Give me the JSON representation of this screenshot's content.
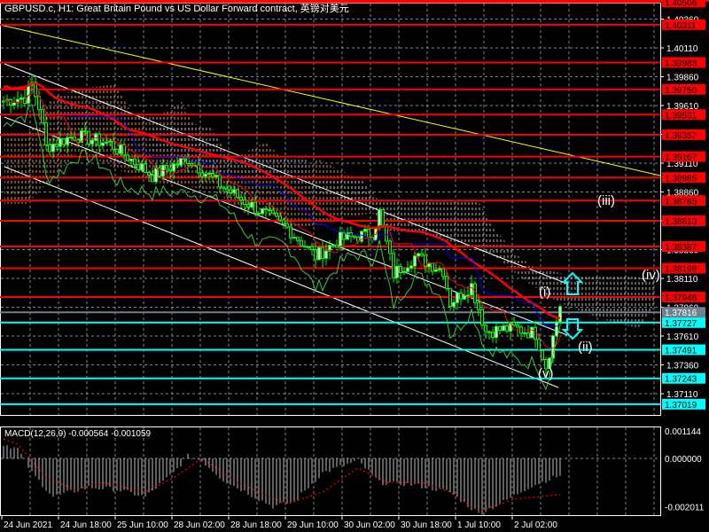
{
  "header": {
    "title": "GBPUSD.c, H1:  Great Britain Pound vs US Dollar Forward contract, 英镑对美元"
  },
  "colors": {
    "background": "#000000",
    "resistance": "#ff0000",
    "support": "#00ffff",
    "current": "#708090",
    "trendline": "#ffff00",
    "channel": "#ffffff",
    "bull_candle": "#00ff00",
    "cloud_a": "#f4a460",
    "cloud_b": "#dcc8c8",
    "kijun": "#0000ff",
    "ma": "#ff0000",
    "oscillator": "#32cd32"
  },
  "chart_data": {
    "type": "candlestick",
    "title": "GBPUSD.c, H1",
    "ylim": [
      1.369,
      1.4055
    ],
    "y_ticks": [
      "1.40360",
      "1.40110",
      "1.39860",
      "1.39610",
      "1.39360",
      "1.39110",
      "1.38860",
      "1.38610",
      "1.38360",
      "1.38110",
      "1.37860",
      "1.37610",
      "1.37360",
      "1.37110"
    ],
    "x_ticks": [
      "24 Jun 2021",
      "24 Jun 18:00",
      "25 Jun 10:00",
      "28 Jun 02:00",
      "28 Jun 18:00",
      "29 Jun 10:00",
      "30 Jun 02:00",
      "30 Jun 18:00",
      "1 Jul 10:00",
      "2 Jul 02:00"
    ],
    "resistance_levels": [
      "1.40506",
      "1.40311",
      "1.39983",
      "1.39750",
      "1.39531",
      "1.39357",
      "1.39167",
      "1.38985",
      "1.38785",
      "1.38610",
      "1.38387",
      "1.38198",
      "1.37948"
    ],
    "support_levels": [
      "1.37727",
      "1.37491",
      "1.37243",
      "1.37019"
    ],
    "current_price": "1.37816",
    "price_path": [
      [
        0,
        1.3965
      ],
      [
        6,
        1.3968
      ],
      [
        8,
        1.398
      ],
      [
        10,
        1.396
      ],
      [
        12,
        1.3925
      ],
      [
        20,
        1.3935
      ],
      [
        30,
        1.3928
      ],
      [
        42,
        1.39
      ],
      [
        52,
        1.3915
      ],
      [
        62,
        1.389
      ],
      [
        72,
        1.387
      ],
      [
        80,
        1.3855
      ],
      [
        88,
        1.383
      ],
      [
        95,
        1.3845
      ],
      [
        104,
        1.385
      ],
      [
        106,
        1.3868
      ],
      [
        110,
        1.3815
      ],
      [
        116,
        1.383
      ],
      [
        124,
        1.3818
      ],
      [
        126,
        1.379
      ],
      [
        132,
        1.3805
      ],
      [
        136,
        1.3765
      ],
      [
        144,
        1.3768
      ],
      [
        150,
        1.3763
      ],
      [
        153,
        1.3735
      ],
      [
        155,
        1.376
      ],
      [
        157,
        1.3788
      ]
    ],
    "wave_labels": [
      "(i)",
      "(ii)",
      "(iii)",
      "(iv)",
      "(v)"
    ],
    "macd": {
      "label": "MACD(12,26,9) -0.000564 -0.001059",
      "ylim": [
        -0.002011,
        0.001144
      ],
      "y_ticks": [
        "0.001144",
        "0.000000",
        "-0.002011"
      ],
      "histogram": [
        [
          0,
          0.0006
        ],
        [
          4,
          0.0004
        ],
        [
          8,
          -0.0006
        ],
        [
          14,
          -0.0016
        ],
        [
          24,
          -0.0012
        ],
        [
          32,
          -0.0013
        ],
        [
          40,
          -0.0016
        ],
        [
          48,
          -0.0006
        ],
        [
          52,
          0.0001
        ],
        [
          56,
          -0.0001
        ],
        [
          62,
          -0.0009
        ],
        [
          76,
          -0.002
        ],
        [
          82,
          -0.0018
        ],
        [
          90,
          -0.0006
        ],
        [
          100,
          -0.0001
        ],
        [
          106,
          -0.001
        ],
        [
          116,
          -0.0011
        ],
        [
          126,
          -0.0014
        ],
        [
          134,
          -0.0023
        ],
        [
          140,
          -0.0019
        ],
        [
          148,
          -0.0012
        ],
        [
          157,
          -0.0007
        ]
      ],
      "signal": [
        [
          0,
          0.0008
        ],
        [
          4,
          0.0006
        ],
        [
          12,
          -0.0008
        ],
        [
          20,
          -0.0013
        ],
        [
          28,
          -0.001
        ],
        [
          40,
          -0.0014
        ],
        [
          48,
          -0.0008
        ],
        [
          56,
          0.0
        ],
        [
          66,
          -0.001
        ],
        [
          80,
          -0.0019
        ],
        [
          90,
          -0.0014
        ],
        [
          100,
          -0.0004
        ],
        [
          108,
          -0.001
        ],
        [
          118,
          -0.001
        ],
        [
          126,
          -0.0014
        ],
        [
          134,
          -0.0022
        ],
        [
          144,
          -0.0017
        ],
        [
          157,
          -0.0015
        ]
      ]
    }
  }
}
